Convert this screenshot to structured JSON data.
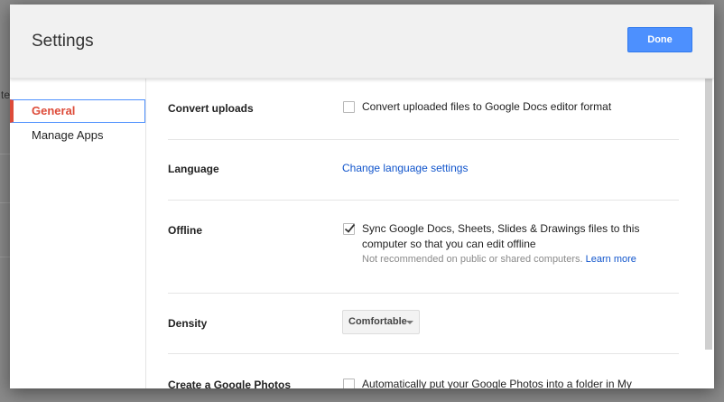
{
  "background": {
    "partial_char": "te"
  },
  "dialog": {
    "title": "Settings",
    "done_label": "Done"
  },
  "sidebar": {
    "items": [
      {
        "label": "General",
        "active": true
      },
      {
        "label": "Manage Apps",
        "active": false
      }
    ]
  },
  "settings": {
    "convert": {
      "label": "Convert uploads",
      "checkbox_label": "Convert uploaded files to Google Docs editor format",
      "checked": false
    },
    "language": {
      "label": "Language",
      "link_text": "Change language settings"
    },
    "offline": {
      "label": "Offline",
      "checkbox_label": "Sync Google Docs, Sheets, Slides & Drawings files to this computer so that you can edit offline",
      "checked": true,
      "hint_text": "Not recommended on public or shared computers.",
      "learn_more": "Learn more"
    },
    "density": {
      "label": "Density",
      "selected": "Comfortable"
    },
    "photos": {
      "label": "Create a Google Photos",
      "checkbox_label": "Automatically put your Google Photos into a folder in My",
      "checked": false
    }
  },
  "colors": {
    "accent_blue": "#4d90fe",
    "active_red": "#dd4b39",
    "link_blue": "#1155cc"
  }
}
